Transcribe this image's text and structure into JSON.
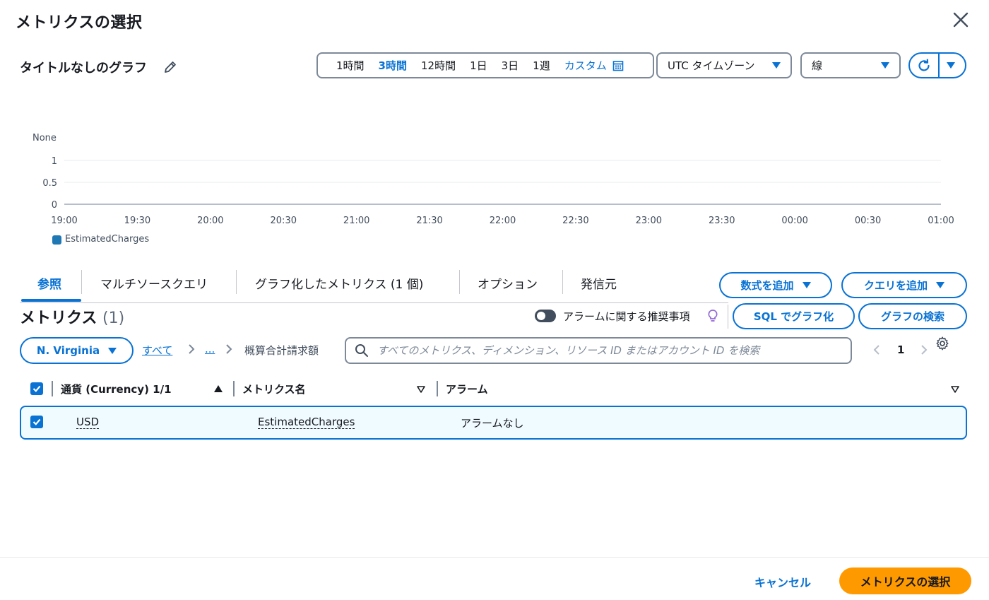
{
  "modal": {
    "title": "メトリクスの選択"
  },
  "graph": {
    "title": "タイトルなしのグラフ"
  },
  "time_range": {
    "options": [
      "1時間",
      "3時間",
      "12時間",
      "1日",
      "3日",
      "1週"
    ],
    "active_index": 1,
    "custom_label": "カスタム"
  },
  "timezone": {
    "selected": "UTC タイムゾーン"
  },
  "graph_type": {
    "selected": "線"
  },
  "chart_data": {
    "type": "line",
    "unit_label": "None",
    "x_ticks": [
      "19:00",
      "19:30",
      "20:00",
      "20:30",
      "21:00",
      "21:30",
      "22:00",
      "22:30",
      "23:00",
      "23:30",
      "00:00",
      "00:30",
      "01:00"
    ],
    "y_ticks": [
      "1",
      "0.5",
      "0"
    ],
    "ylim": [
      0,
      1
    ],
    "series": [
      {
        "name": "EstimatedCharges",
        "values": []
      }
    ],
    "legend": "bottom-left",
    "grid": true,
    "colors": {
      "series": "#1f77b4"
    }
  },
  "tabs": [
    {
      "label": "参照",
      "active": true
    },
    {
      "label": "マルチソースクエリ"
    },
    {
      "label": "グラフ化したメトリクス (1 個)"
    },
    {
      "label": "オプション"
    },
    {
      "label": "発信元"
    }
  ],
  "actions": {
    "add_math": "数式を追加",
    "add_query": "クエリを追加",
    "sql_graph": "SQL でグラフ化",
    "graph_search": "グラフの検索"
  },
  "metrics": {
    "heading": "メトリクス",
    "count": "(1)",
    "alarm_recommendations": "アラームに関する推奨事項"
  },
  "region": {
    "selected": "N. Virginia"
  },
  "breadcrumb": {
    "all": "すべて",
    "ellipsis": "...",
    "current": "概算合計請求額"
  },
  "search": {
    "placeholder": "すべてのメトリクス、ディメンション、リソース ID またはアカウント ID を検索"
  },
  "pagination": {
    "page": "1"
  },
  "table": {
    "columns": [
      "通貨 (Currency) 1/1",
      "メトリクス名",
      "アラーム"
    ],
    "rows": [
      {
        "currency": "USD",
        "metric": "EstimatedCharges",
        "alarm": "アラームなし",
        "selected": true
      }
    ]
  },
  "footer": {
    "cancel": "キャンセル",
    "select": "メトリクスの選択"
  },
  "colors": {
    "accent": "#0972d3",
    "primary_button": "#ff9900",
    "selected_row": "#f0fbff"
  }
}
